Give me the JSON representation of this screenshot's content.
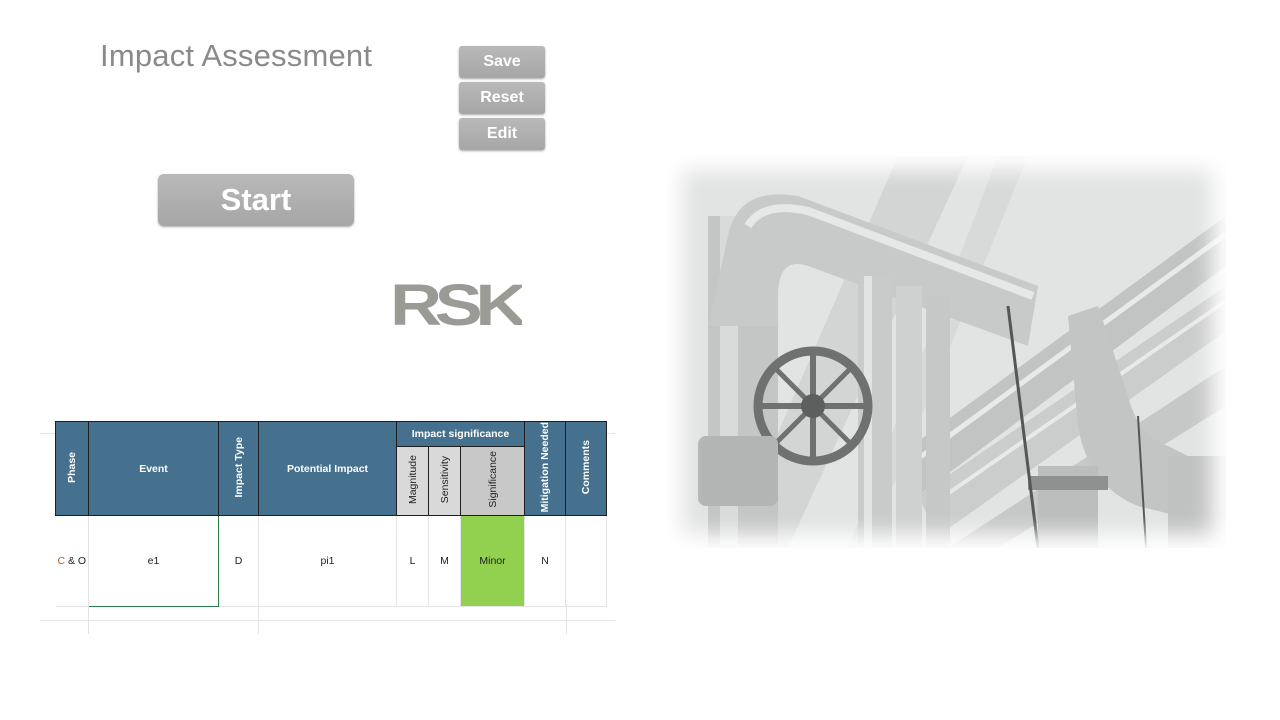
{
  "header": {
    "title": "Impact Assessment"
  },
  "buttons": {
    "save": "Save",
    "reset": "Reset",
    "edit": "Edit",
    "start": "Start"
  },
  "logo": {
    "text": "RSK",
    "color": "#9a9b95"
  },
  "table": {
    "header_color": "#45718f",
    "columns": {
      "phase": "Phase",
      "event": "Event",
      "impact_type": "Impact Type",
      "potential_impact": "Potential Impact",
      "impact_significance": "Impact significance",
      "magnitude": "Magnitude",
      "sensitivity": "Sensitivity",
      "significance": "Significance",
      "mitigation": "Mitigation Needed",
      "comments": "Comments"
    },
    "row": {
      "phase_c": "C",
      "phase_rest": " & O",
      "event": "e1",
      "impact_type": "D",
      "potential_impact": "pi1",
      "magnitude": "L",
      "sensitivity": "M",
      "significance": "Minor",
      "mitigation": "N",
      "comments": ""
    },
    "significance_color": "#92d050"
  },
  "photo": {
    "subject": "industrial-pipes-photo"
  }
}
